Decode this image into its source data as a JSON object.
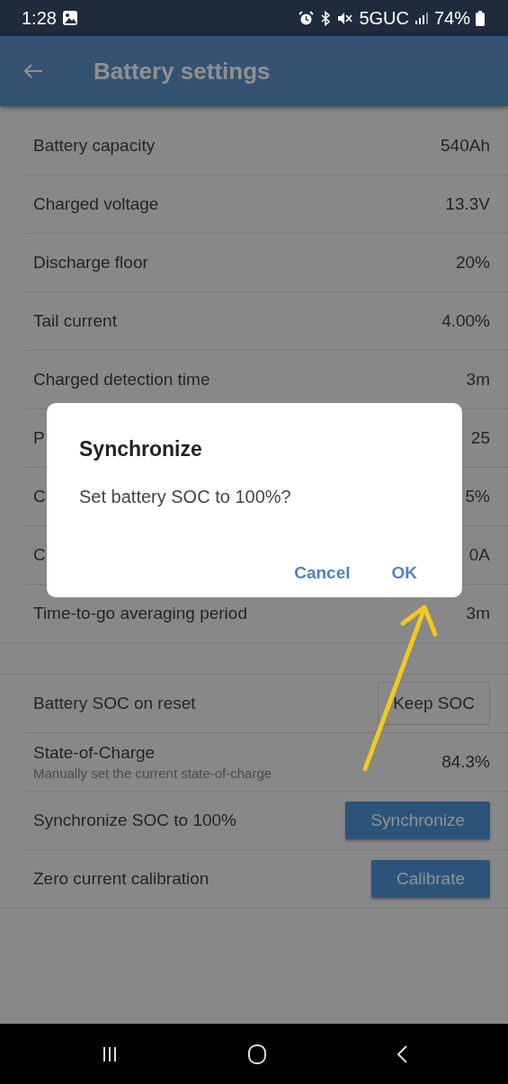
{
  "status_bar": {
    "time": "1:28",
    "network": "5GUC",
    "battery": "74%"
  },
  "app_bar": {
    "title": "Battery settings"
  },
  "sections": [
    {
      "rows": [
        {
          "kind": "value",
          "label": "Battery capacity",
          "value": "540Ah"
        },
        {
          "kind": "value",
          "label": "Charged voltage",
          "value": "13.3V"
        },
        {
          "kind": "value",
          "label": "Discharge floor",
          "value": "20%"
        },
        {
          "kind": "value",
          "label": "Tail current",
          "value": "4.00%"
        },
        {
          "kind": "value",
          "label": "Charged detection time",
          "value": "3m"
        },
        {
          "kind": "value",
          "label": "P",
          "value": "25"
        },
        {
          "kind": "value",
          "label": "C",
          "value": "5%"
        },
        {
          "kind": "value",
          "label": "C",
          "value": "0A"
        },
        {
          "kind": "value",
          "label": "Time-to-go averaging period",
          "value": "3m"
        }
      ]
    },
    {
      "rows": [
        {
          "kind": "outlined_button",
          "label": "Battery SOC on reset",
          "value": "Keep SOC"
        },
        {
          "kind": "value",
          "label": "State-of-Charge",
          "description": "Manually set the current state-of-charge",
          "value": "84.3%"
        },
        {
          "kind": "button",
          "label": "Synchronize SOC to 100%",
          "value": "Synchronize"
        },
        {
          "kind": "button",
          "label": "Zero current calibration",
          "value": "Calibrate"
        }
      ]
    }
  ],
  "dialog": {
    "title": "Synchronize",
    "message": "Set battery SOC to 100%?",
    "buttons": [
      "Cancel",
      "OK"
    ]
  }
}
